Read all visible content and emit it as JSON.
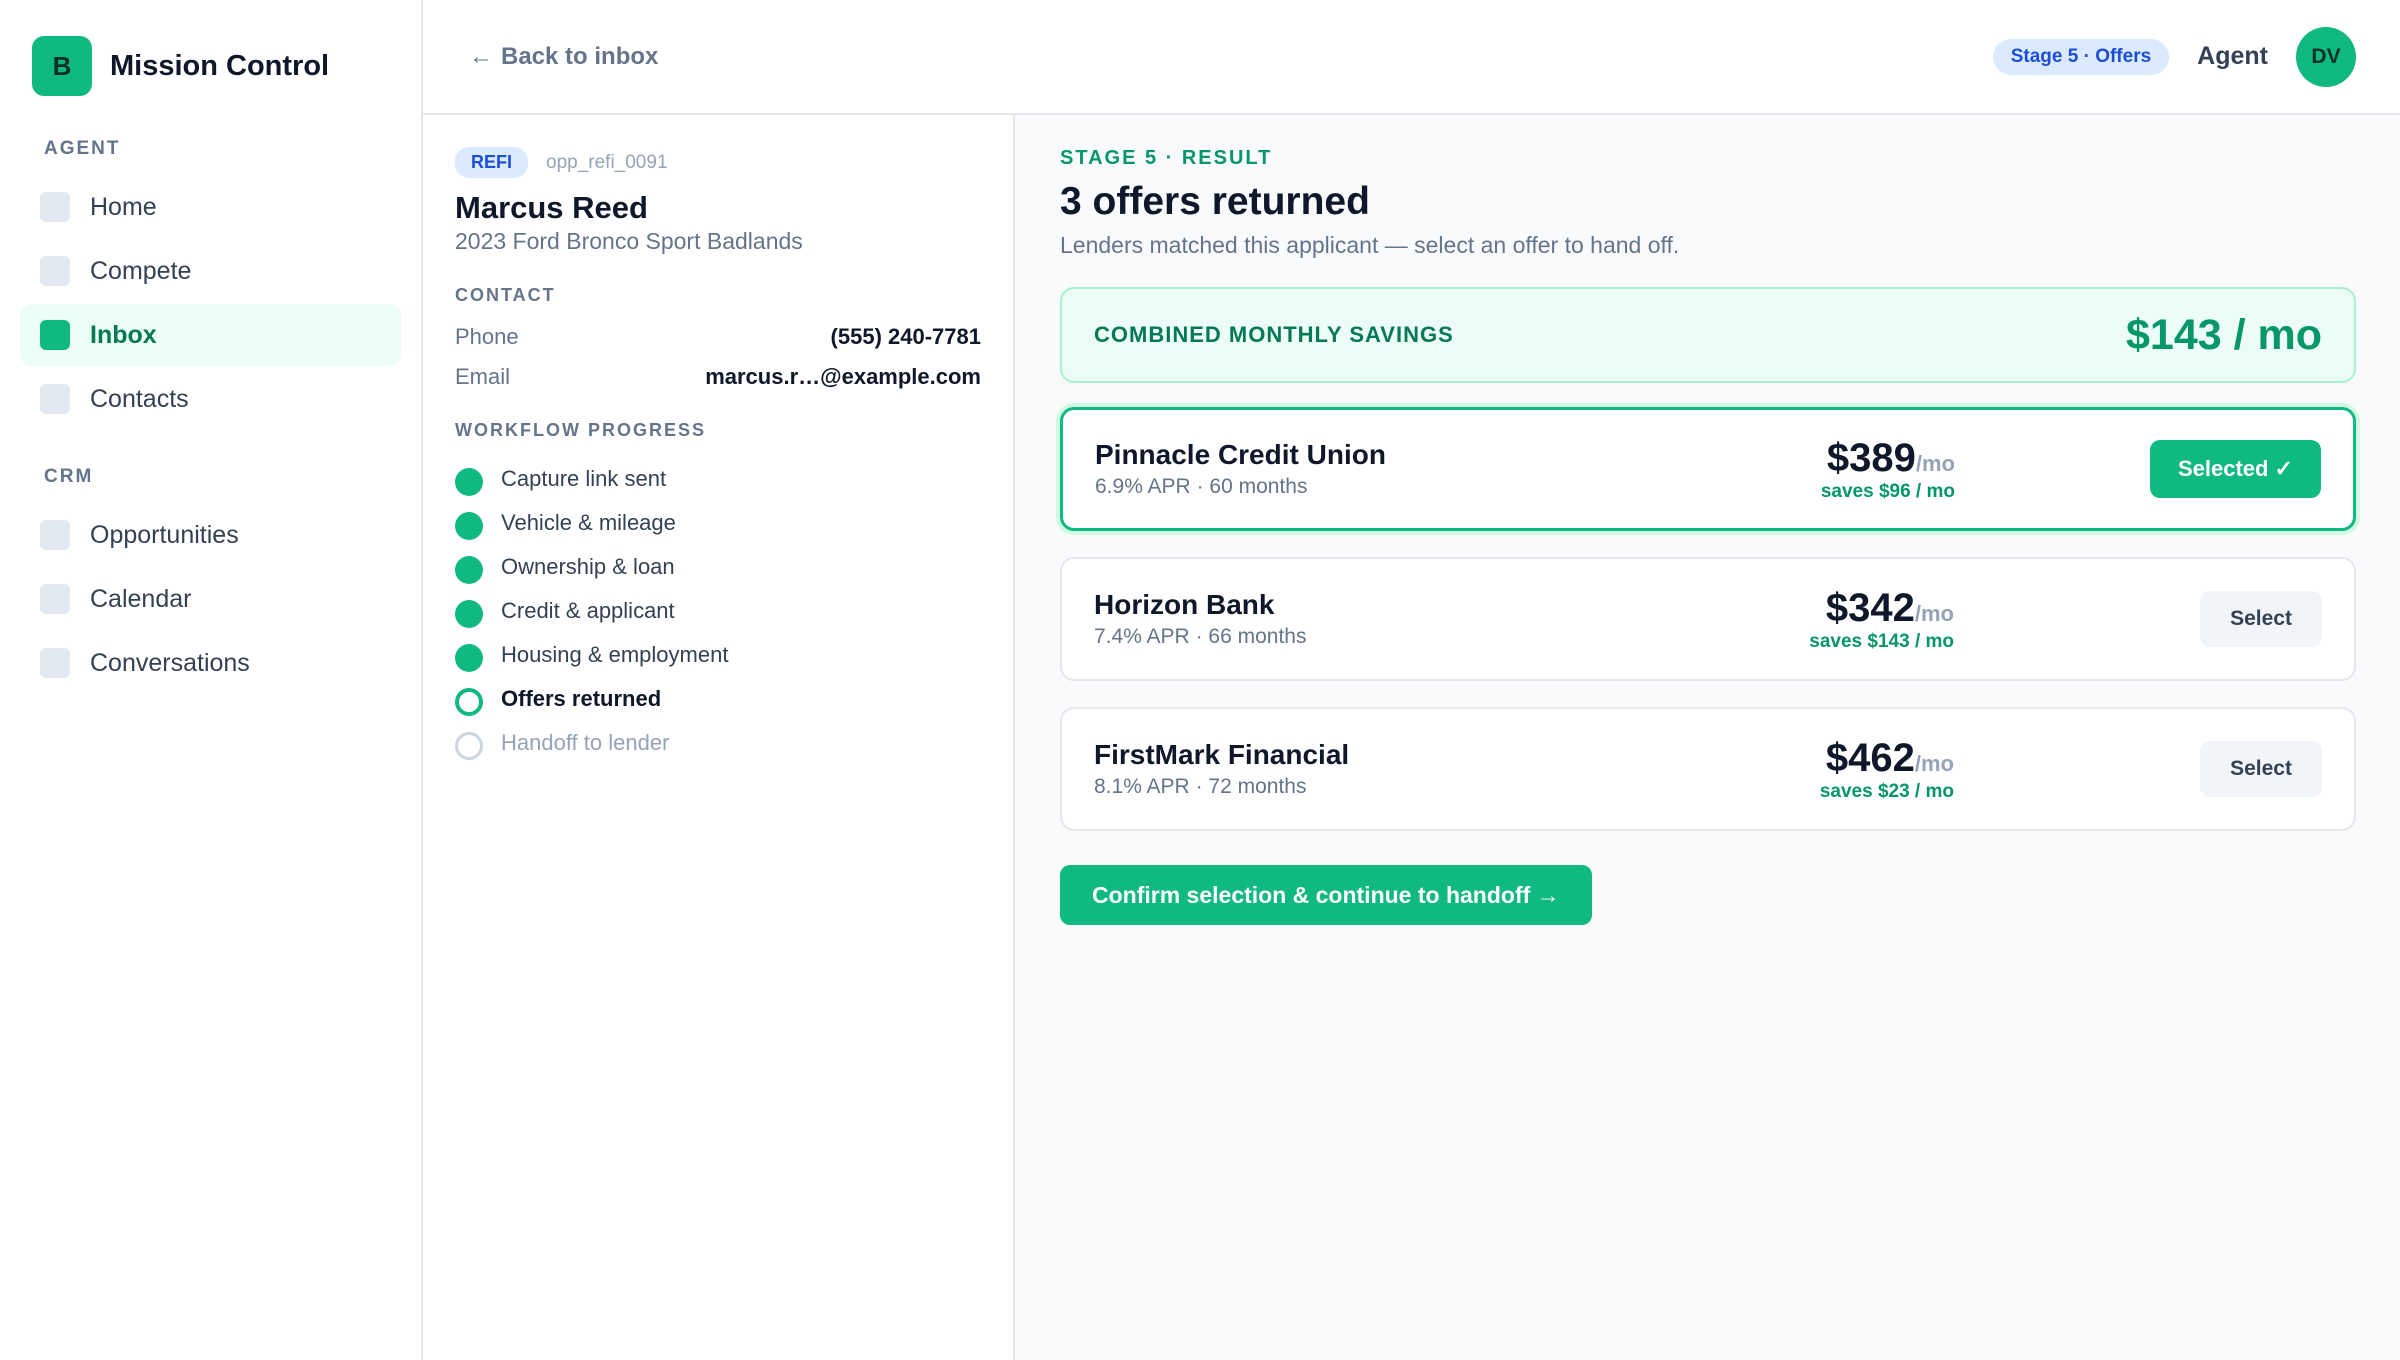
{
  "brand": {
    "logo_letter": "B",
    "name": "Mission Control"
  },
  "sidebar": {
    "agent_section": "AGENT",
    "agent_items": [
      {
        "label": "Home",
        "active": false
      },
      {
        "label": "Compete",
        "active": false
      },
      {
        "label": "Inbox",
        "active": true
      },
      {
        "label": "Contacts",
        "active": false
      }
    ],
    "crm_section": "CRM",
    "crm_items": [
      {
        "label": "Opportunities"
      },
      {
        "label": "Calendar"
      },
      {
        "label": "Conversations"
      }
    ]
  },
  "topbar": {
    "back_arrow": "←",
    "back_label": "Back to inbox",
    "stage_pill": "Stage 5 · Offers",
    "role": "Agent",
    "avatar_initials": "DV"
  },
  "detail": {
    "type_badge": "REFI",
    "opportunity_id": "opp_refi_0091",
    "applicant_name": "Marcus Reed",
    "vehicle": "2023 Ford Bronco Sport Badlands",
    "contact_label": "CONTACT",
    "phone_label": "Phone",
    "phone_value": "(555) 240-7781",
    "email_label": "Email",
    "email_value": "marcus.r…@example.com",
    "workflow_label": "WORKFLOW PROGRESS",
    "steps": [
      {
        "label": "Capture link sent",
        "status": "done"
      },
      {
        "label": "Vehicle & mileage",
        "status": "done"
      },
      {
        "label": "Ownership & loan",
        "status": "done"
      },
      {
        "label": "Credit & applicant",
        "status": "done"
      },
      {
        "label": "Housing & employment",
        "status": "done"
      },
      {
        "label": "Offers returned",
        "status": "current"
      },
      {
        "label": "Handoff to lender",
        "status": "pending"
      }
    ]
  },
  "offers": {
    "eyebrow": "STAGE 5 · RESULT",
    "title": "3 offers returned",
    "subtitle": "Lenders matched this applicant — select an offer to hand off.",
    "savings_label": "COMBINED MONTHLY SAVINGS",
    "savings_value": "$143 / mo",
    "per_month_suffix": "/mo",
    "items": [
      {
        "lender": "Pinnacle Credit Union",
        "apr": "6.9% APR",
        "term": "60 months",
        "payment": "$389",
        "saves": "saves $96 / mo",
        "action": "Selected ✓",
        "selected": true
      },
      {
        "lender": "Horizon Bank",
        "apr": "7.4% APR",
        "term": "66 months",
        "payment": "$342",
        "saves": "saves $143 / mo",
        "action": "Select",
        "selected": false
      },
      {
        "lender": "FirstMark Financial",
        "apr": "8.1% APR",
        "term": "72 months",
        "payment": "$462",
        "saves": "saves $23 / mo",
        "action": "Select",
        "selected": false
      }
    ],
    "term_separator": " · ",
    "confirm_label": "Confirm selection & continue to handoff →"
  },
  "colors": {
    "accent": "#10b981",
    "accent_dark": "#059669",
    "info_bg": "#dbeafe",
    "info_text": "#1d4ed8"
  }
}
